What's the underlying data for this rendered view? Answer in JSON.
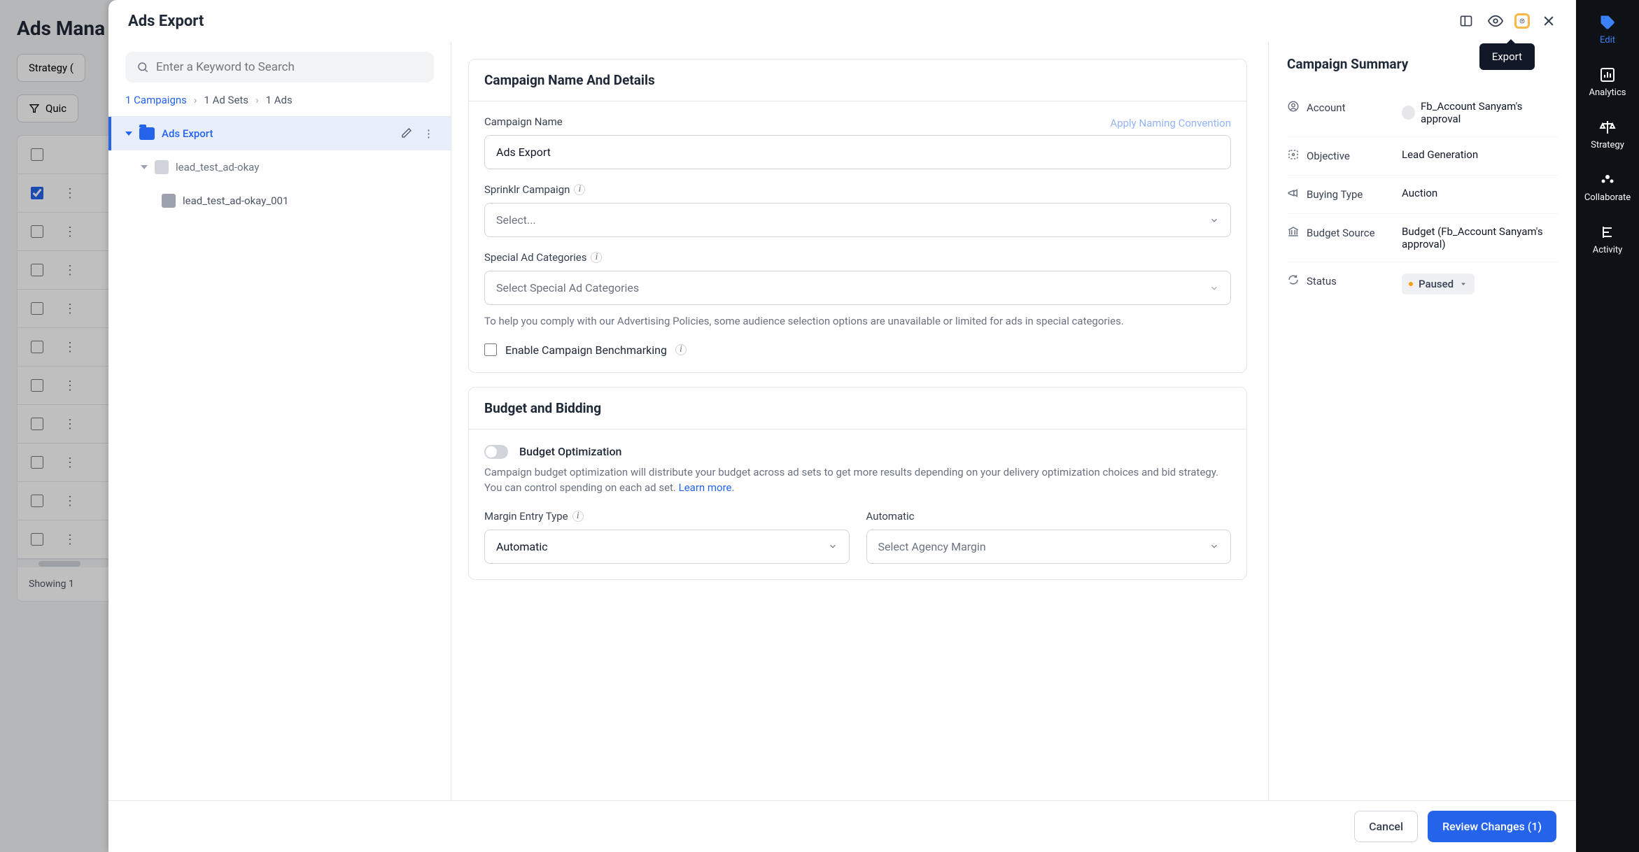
{
  "background": {
    "title": "Ads Mana",
    "strategy_button": "Strategy (",
    "quick_label": "Quic",
    "footer_showing": "Showing 1"
  },
  "rail": {
    "items": [
      {
        "label": "Edit",
        "active": true
      },
      {
        "label": "Analytics"
      },
      {
        "label": "Strategy"
      },
      {
        "label": "Collaborate"
      },
      {
        "label": "Activity"
      }
    ]
  },
  "modal": {
    "title": "Ads Export",
    "tooltip": "Export",
    "search_placeholder": "Enter a Keyword to Search",
    "crumbs": {
      "campaigns": "1 Campaigns",
      "adsets": "1 Ad Sets",
      "ads": "1 Ads"
    },
    "tree": {
      "root": "Ads Export",
      "adset": "lead_test_ad-okay",
      "ad": "lead_test_ad-okay_001"
    },
    "campaign_section": {
      "title": "Campaign Name And Details",
      "naming_link": "Apply Naming Convention",
      "name_label": "Campaign Name",
      "name_value": "Ads Export",
      "sprinklr_label": "Sprinklr Campaign",
      "sprinklr_placeholder": "Select...",
      "special_label": "Special Ad Categories",
      "special_placeholder": "Select Special Ad Categories",
      "special_help": "To help you comply with our Advertising Policies, some audience selection options are unavailable or limited for ads in special categories.",
      "benchmark_label": "Enable Campaign Benchmarking"
    },
    "budget_section": {
      "title": "Budget and Bidding",
      "optimize_label": "Budget Optimization",
      "optimize_help": "Campaign budget optimization will distribute your budget across ad sets to get more results depending on your delivery optimization choices and bid strategy. You can control spending on each ad set. ",
      "learn_more": "Learn more.",
      "margin_label": "Margin Entry Type",
      "margin_value": "Automatic",
      "automatic_label": "Automatic",
      "automatic_placeholder": "Select Agency Margin"
    },
    "summary": {
      "title": "Campaign Summary",
      "rows": {
        "account_k": "Account",
        "account_v": "Fb_Account Sanyam's approval",
        "objective_k": "Objective",
        "objective_v": "Lead Generation",
        "buying_k": "Buying Type",
        "buying_v": "Auction",
        "budget_k": "Budget Source",
        "budget_v": "Budget (Fb_Account Sanyam's approval)",
        "status_k": "Status",
        "status_v": "Paused"
      }
    },
    "footer": {
      "cancel": "Cancel",
      "review": "Review Changes (1)"
    }
  }
}
